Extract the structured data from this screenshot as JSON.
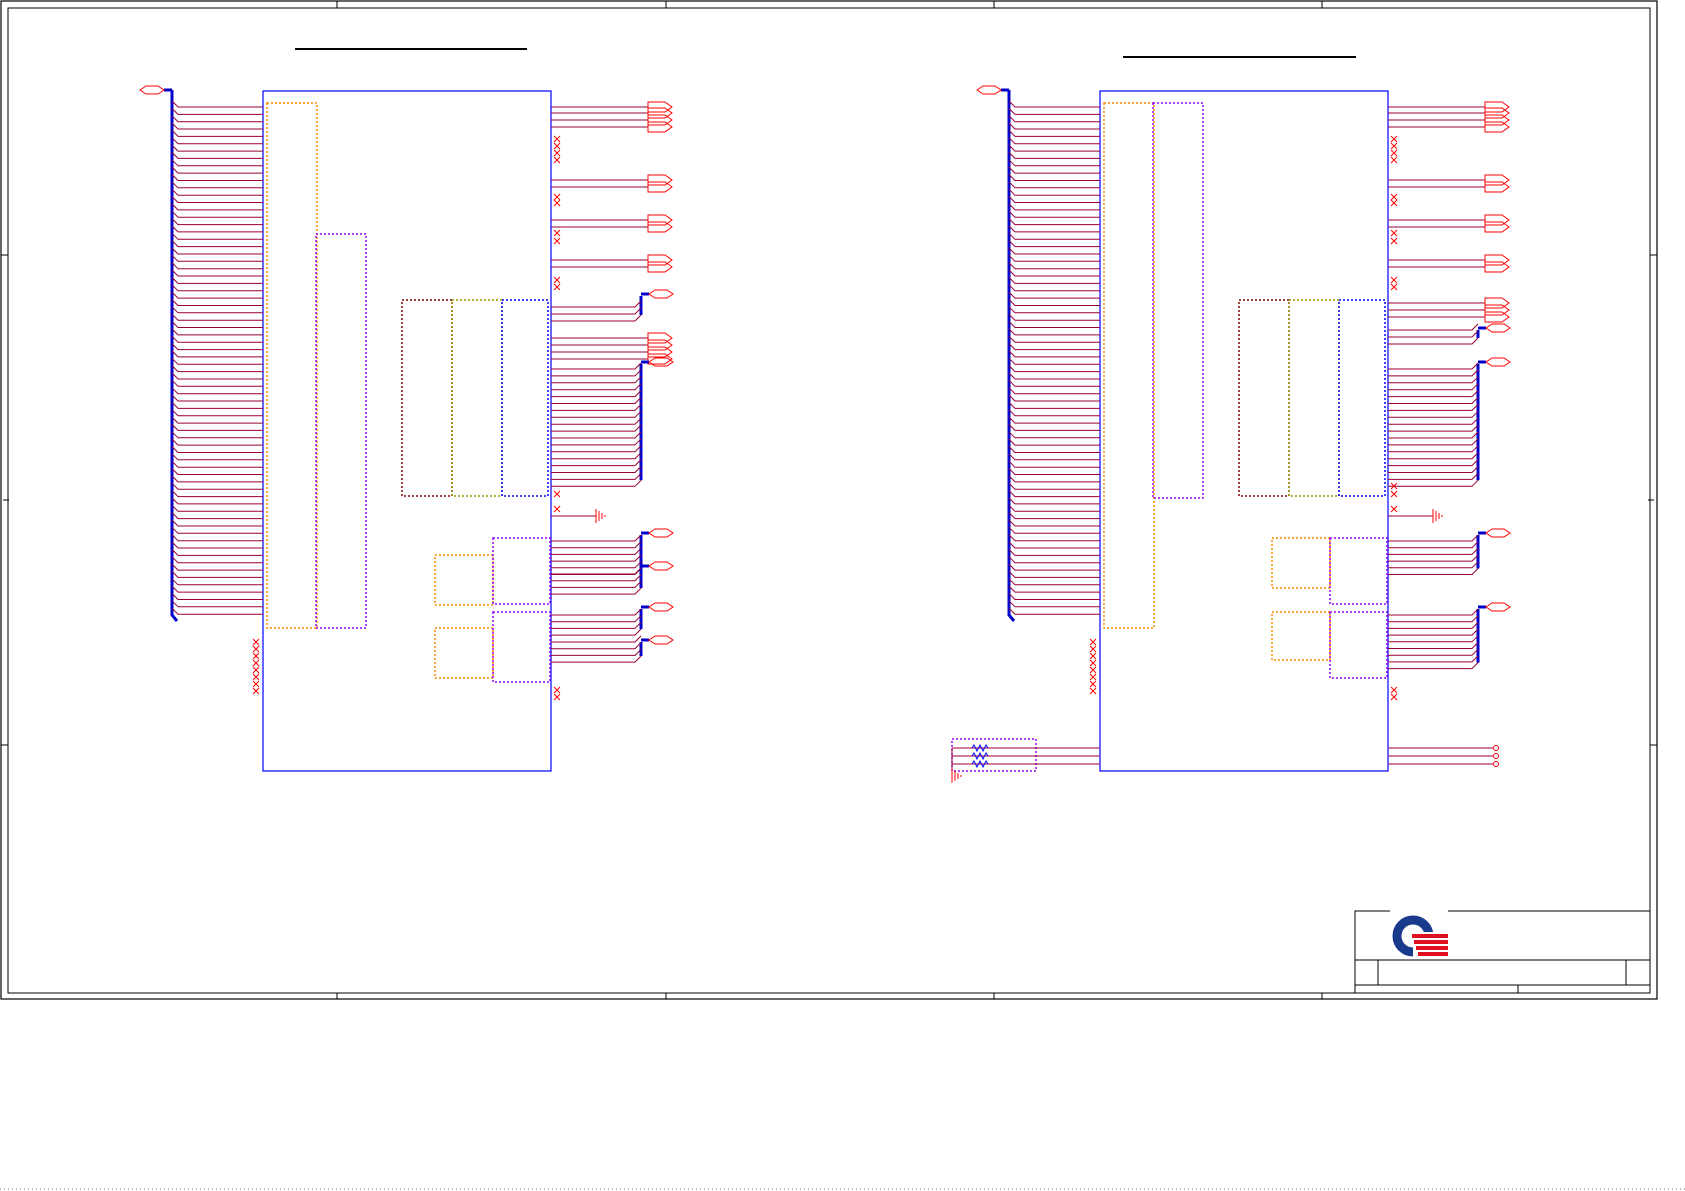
{
  "title_block": {
    "logo": "quanta-logo",
    "company": "",
    "title": "",
    "size": "",
    "doc_number": "",
    "rev": "",
    "sheet": ""
  },
  "colors": {
    "border": "#000000",
    "component": "#0000ff",
    "net": "#990033",
    "bus": "#0000cc",
    "port": "#ff0000",
    "group_orange": "#ff8c00",
    "group_purple": "#9900ff",
    "group_maroon": "#800000",
    "group_olive": "#999900",
    "group_blue": "#0000ff",
    "logo_blue": "#1a3a8c",
    "logo_red": "#e0101e"
  },
  "sheets": [
    {
      "id": "left-ddr-socket",
      "label": ""
    },
    {
      "id": "right-ddr-socket",
      "label": ""
    }
  ]
}
